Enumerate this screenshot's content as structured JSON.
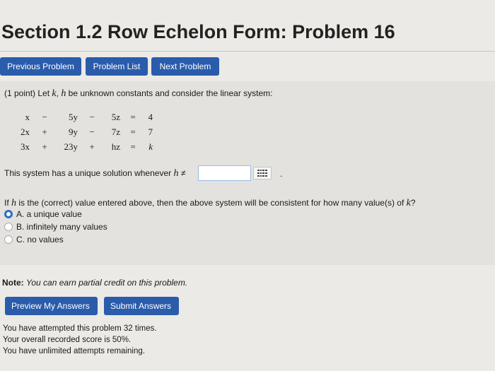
{
  "page": {
    "title": "Section 1.2 Row Echelon Form: Problem 16"
  },
  "nav": {
    "previous": "Previous Problem",
    "list": "Problem List",
    "next": "Next Problem"
  },
  "problem": {
    "points": "(1 point)",
    "intro_prefix": "Let",
    "var_k": "k",
    "comma": ",",
    "var_h": "h",
    "intro_suffix": "be unknown constants and consider the linear system:",
    "system": [
      [
        "x",
        "−",
        "5y",
        "−",
        "5z",
        "=",
        "4"
      ],
      [
        "2x",
        "+",
        "9y",
        "−",
        "7z",
        "=",
        "7"
      ],
      [
        "3x",
        "+",
        "23y",
        "+",
        "hz",
        "=",
        "k"
      ]
    ],
    "unique_prefix": "This system has a unique solution whenever",
    "unique_var": "h",
    "neq": "≠",
    "answer_value": "",
    "period": ".",
    "consistent_q_prefix": "If",
    "consistent_q_var_h": "h",
    "consistent_q_mid": "is the (correct) value entered above, then the above system will be consistent for how many value(s) of",
    "consistent_q_var_k": "k",
    "consistent_q_suffix": "?",
    "options": [
      {
        "label": "A. a unique value",
        "selected": true
      },
      {
        "label": "B. infinitely many values",
        "selected": false
      },
      {
        "label": "C. no values",
        "selected": false
      }
    ]
  },
  "note": {
    "label": "Note:",
    "text": "You can earn partial credit on this problem."
  },
  "actions": {
    "preview": "Preview My Answers",
    "submit": "Submit Answers"
  },
  "status": {
    "attempts": "You have attempted this problem 32 times.",
    "score": "Your overall recorded score is 50%.",
    "remaining": "You have unlimited attempts remaining."
  },
  "colors": {
    "button": "#2a5cab",
    "radio_selected": "#2a6fc8",
    "input_border": "#9bbbe8"
  }
}
